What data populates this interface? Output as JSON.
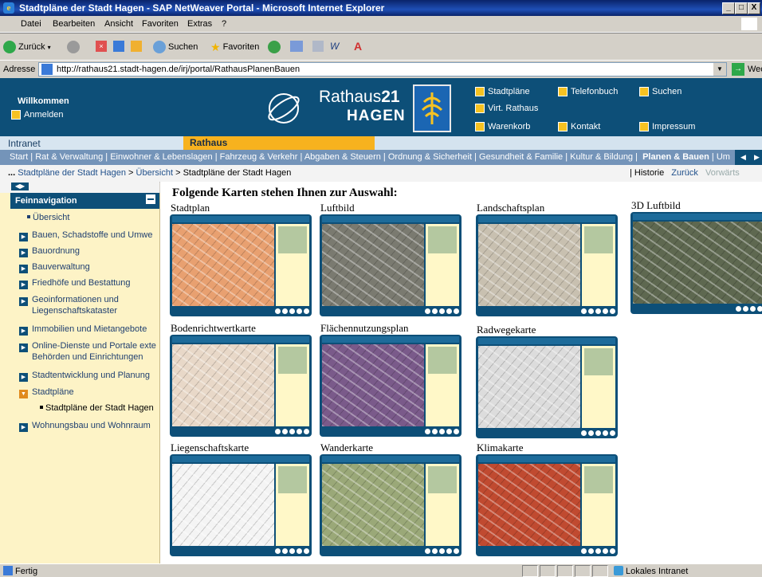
{
  "window": {
    "title": "Stadtpläne der Stadt Hagen - SAP NetWeaver Portal - Microsoft Internet Explorer",
    "min": "_",
    "max": "□",
    "close": "X"
  },
  "menu": [
    "Datei",
    "Bearbeiten",
    "Ansicht",
    "Favoriten",
    "Extras",
    "?"
  ],
  "toolbar": {
    "back": "Zurück",
    "search": "Suchen",
    "favorites": "Favoriten"
  },
  "address": {
    "label": "Adresse",
    "url": "http://rathaus21.stadt-hagen.de/irj/portal/RathausPlanenBauen",
    "go": "Wechseln zu"
  },
  "header": {
    "welcome": "Willkommen",
    "login": "Anmelden",
    "brand_line1": "Rathaus",
    "brand_line1_num": "21",
    "brand_line2": "HAGEN",
    "links": [
      "Stadtpläne",
      "Telefonbuch",
      "Suchen",
      "Virt. Rathaus",
      "Warenkorb",
      "Kontakt",
      "Impressum"
    ],
    "colors": {
      "header_bg": "#0d4f78",
      "accent": "#f6c222"
    }
  },
  "tabs": {
    "intranet": "Intranet",
    "rathaus": "Rathaus"
  },
  "nav": {
    "items": [
      "Start",
      "Rat & Verwaltung",
      "Einwohner & Lebenslagen",
      "Fahrzeug & Verkehr",
      "Abgaben & Steuern",
      "Ordnung & Sicherheit",
      "Gesundheit & Familie",
      "Kultur & Bildung"
    ],
    "active": "Planen & Bauen",
    "cut": "Um"
  },
  "breadcrumb": {
    "prefix": "...",
    "items": [
      "Stadtpläne der Stadt Hagen",
      "Übersicht",
      "Stadtpläne der Stadt Hagen"
    ],
    "history": "Historie",
    "back": "Zurück",
    "forward": "Vorwärts"
  },
  "sidebar": {
    "title": "Feinnavigation",
    "items": [
      {
        "label": "Übersicht",
        "type": "sub"
      },
      {
        "label": "Bauen, Schadstoffe und Umwe",
        "type": "folder"
      },
      {
        "label": "Bauordnung",
        "type": "folder"
      },
      {
        "label": "Bauverwaltung",
        "type": "folder"
      },
      {
        "label": "Friedhöfe und Bestattung",
        "type": "folder"
      },
      {
        "label": "Geoinformationen und",
        "label2": "Liegenschaftskataster",
        "type": "folder"
      },
      {
        "label": "Immobilien und Mietangebote",
        "type": "folder"
      },
      {
        "label": "Online-Dienste und Portale exte",
        "label2": "Behörden und Einrichtungen",
        "type": "folder"
      },
      {
        "label": "Stadtentwicklung und Planung",
        "type": "folder"
      },
      {
        "label": "Stadtpläne",
        "type": "open"
      },
      {
        "label": "Stadtpläne der Stadt Hagen",
        "type": "subsub"
      },
      {
        "label": "Wohnungsbau und Wohnraum",
        "type": "folder"
      }
    ]
  },
  "content": {
    "heading": "Folgende Karten stehen Ihnen zur Auswahl:",
    "maps": [
      {
        "label": "Stadtplan",
        "color": "#e8a070"
      },
      {
        "label": "Luftbild",
        "color": "#7a7a70"
      },
      {
        "label": "Landschaftsplan",
        "color": "#c8c0b0"
      },
      {
        "label": "3D Luftbild",
        "color": "#5e6850"
      },
      {
        "label": "Bodenrichtwertkarte",
        "color": "#e8d8c8"
      },
      {
        "label": "Flächennutzungsplan",
        "color": "#7a5a8a"
      },
      {
        "label": "Radwegekarte",
        "color": "#dcdcdc"
      },
      {
        "label": "Liegenschaftskarte",
        "color": "#f4f4f4"
      },
      {
        "label": "Wanderkarte",
        "color": "#9aa878"
      },
      {
        "label": "Klimakarte",
        "color": "#c04a30"
      }
    ]
  },
  "status": {
    "left": "Fertig",
    "right": "Lokales Intranet"
  }
}
